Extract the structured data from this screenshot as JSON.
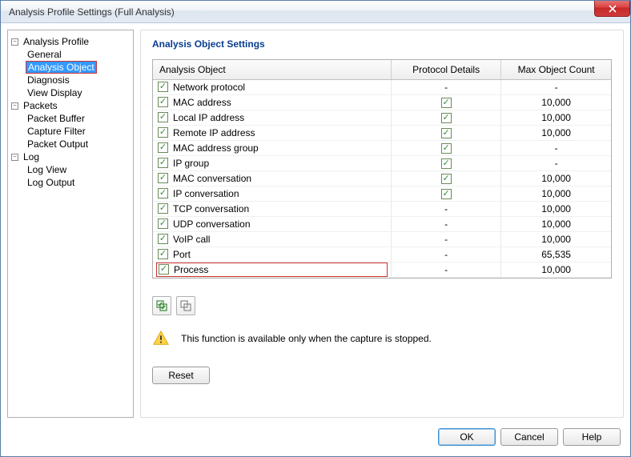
{
  "window": {
    "title": "Analysis Profile Settings (Full Analysis)"
  },
  "tree": {
    "analysis_profile": {
      "label": "Analysis Profile",
      "expanded": true
    },
    "general": "General",
    "analysis_object": "Analysis Object",
    "diagnosis": "Diagnosis",
    "view_display": "View Display",
    "packets": {
      "label": "Packets",
      "expanded": true
    },
    "packet_buffer": "Packet Buffer",
    "capture_filter": "Capture Filter",
    "packet_output": "Packet Output",
    "log": {
      "label": "Log",
      "expanded": true
    },
    "log_view": "Log View",
    "log_output": "Log Output"
  },
  "panel": {
    "title": "Analysis Object Settings",
    "columns": {
      "c1": "Analysis Object",
      "c2": "Protocol Details",
      "c3": "Max Object Count"
    },
    "rows": [
      {
        "name": "Network protocol",
        "checked": true,
        "protocol_details": "-",
        "max_count": "-"
      },
      {
        "name": "MAC address",
        "checked": true,
        "protocol_details": "check",
        "max_count": "10,000"
      },
      {
        "name": "Local IP address",
        "checked": true,
        "protocol_details": "check",
        "max_count": "10,000"
      },
      {
        "name": "Remote IP address",
        "checked": true,
        "protocol_details": "check",
        "max_count": "10,000"
      },
      {
        "name": "MAC address group",
        "checked": true,
        "protocol_details": "check",
        "max_count": "-"
      },
      {
        "name": "IP group",
        "checked": true,
        "protocol_details": "check",
        "max_count": "-"
      },
      {
        "name": "MAC conversation",
        "checked": true,
        "protocol_details": "check",
        "max_count": "10,000"
      },
      {
        "name": "IP conversation",
        "checked": true,
        "protocol_details": "check",
        "max_count": "10,000"
      },
      {
        "name": "TCP conversation",
        "checked": true,
        "protocol_details": "-",
        "max_count": "10,000"
      },
      {
        "name": "UDP conversation",
        "checked": true,
        "protocol_details": "-",
        "max_count": "10,000"
      },
      {
        "name": "VoIP call",
        "checked": true,
        "protocol_details": "-",
        "max_count": "10,000"
      },
      {
        "name": "Port",
        "checked": true,
        "protocol_details": "-",
        "max_count": "65,535"
      },
      {
        "name": "Process",
        "checked": true,
        "protocol_details": "-",
        "max_count": "10,000",
        "highlight": true
      }
    ],
    "info_text": "This function is available only when the capture is stopped.",
    "reset_label": "Reset"
  },
  "footer": {
    "ok": "OK",
    "cancel": "Cancel",
    "help": "Help"
  }
}
